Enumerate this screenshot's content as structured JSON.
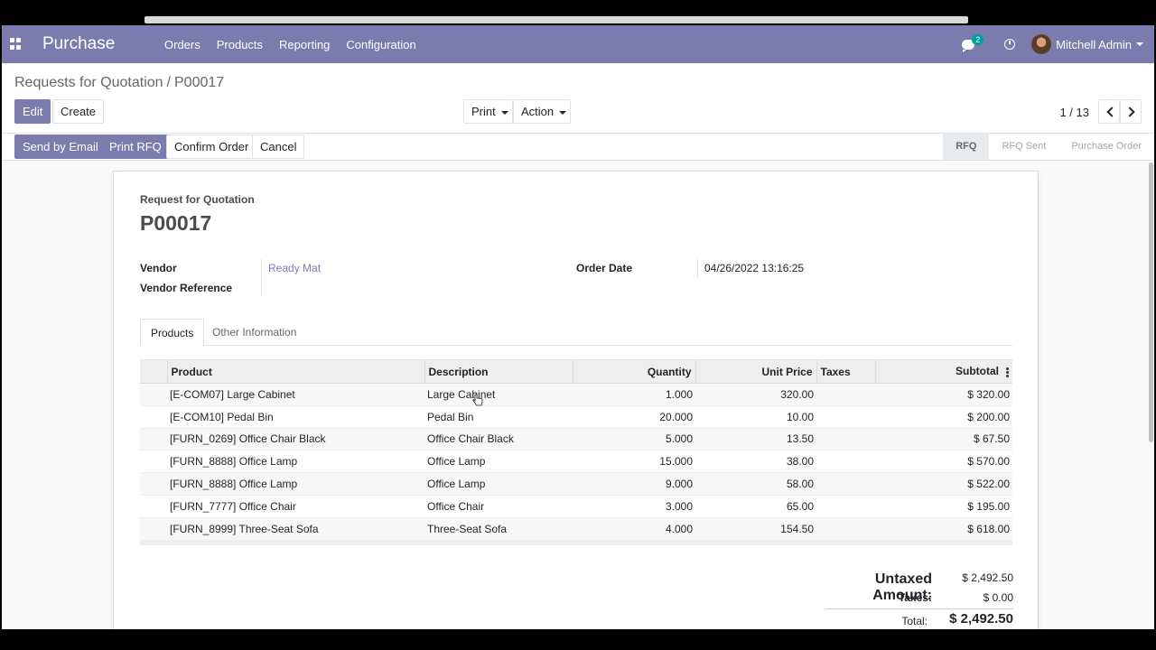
{
  "navbar": {
    "app_name": "Purchase",
    "menu": [
      "Orders",
      "Products",
      "Reporting",
      "Configuration"
    ],
    "messages_count": "2",
    "user_name": "Mitchell Admin",
    "color": "#7c7bad"
  },
  "breadcrumb": {
    "parent": "Requests for Quotation",
    "separator": "/",
    "current": "P00017"
  },
  "buttons": {
    "edit": "Edit",
    "create": "Create",
    "print": "Print",
    "action": "Action",
    "send_email": "Send by Email",
    "print_rfq": "Print RFQ",
    "confirm": "Confirm Order",
    "cancel": "Cancel"
  },
  "pager": {
    "value": "1 / 13"
  },
  "stages": {
    "rfq": "RFQ",
    "rfq_sent": "RFQ Sent",
    "purchase_order": "Purchase Order",
    "current": "RFQ"
  },
  "document": {
    "label": "Request for Quotation",
    "number": "P00017",
    "vendor_label": "Vendor",
    "vendor_value": "Ready Mat",
    "vendor_ref_label": "Vendor Reference",
    "vendor_ref_value": "",
    "order_date_label": "Order Date",
    "order_date_value": "04/26/2022 13:16:25"
  },
  "tabs": {
    "products": "Products",
    "other": "Other Information",
    "active": "Products"
  },
  "table": {
    "headers": {
      "product": "Product",
      "description": "Description",
      "quantity": "Quantity",
      "unit_price": "Unit Price",
      "taxes": "Taxes",
      "subtotal": "Subtotal"
    },
    "rows": [
      {
        "product": "[E-COM07] Large Cabinet",
        "description": "Large Cabinet",
        "quantity": "1.000",
        "unit_price": "320.00",
        "taxes": "",
        "subtotal": "$ 320.00"
      },
      {
        "product": "[E-COM10] Pedal Bin",
        "description": "Pedal Bin",
        "quantity": "20.000",
        "unit_price": "10.00",
        "taxes": "",
        "subtotal": "$ 200.00"
      },
      {
        "product": "[FURN_0269] Office Chair Black",
        "description": "Office Chair Black",
        "quantity": "5.000",
        "unit_price": "13.50",
        "taxes": "",
        "subtotal": "$ 67.50"
      },
      {
        "product": "[FURN_8888] Office Lamp",
        "description": "Office Lamp",
        "quantity": "15.000",
        "unit_price": "38.00",
        "taxes": "",
        "subtotal": "$ 570.00"
      },
      {
        "product": "[FURN_8888] Office Lamp",
        "description": "Office Lamp",
        "quantity": "9.000",
        "unit_price": "58.00",
        "taxes": "",
        "subtotal": "$ 522.00"
      },
      {
        "product": "[FURN_7777] Office Chair",
        "description": "Office Chair",
        "quantity": "3.000",
        "unit_price": "65.00",
        "taxes": "",
        "subtotal": "$ 195.00"
      },
      {
        "product": "[FURN_8999] Three-Seat Sofa",
        "description": "Three-Seat Sofa",
        "quantity": "4.000",
        "unit_price": "154.50",
        "taxes": "",
        "subtotal": "$ 618.00"
      }
    ]
  },
  "totals": {
    "untaxed_label": "Untaxed Amount:",
    "untaxed_value": "$ 2,492.50",
    "taxes_label": "Taxes:",
    "taxes_value": "$ 0.00",
    "total_label": "Total:",
    "total_value": "$ 2,492.50"
  }
}
